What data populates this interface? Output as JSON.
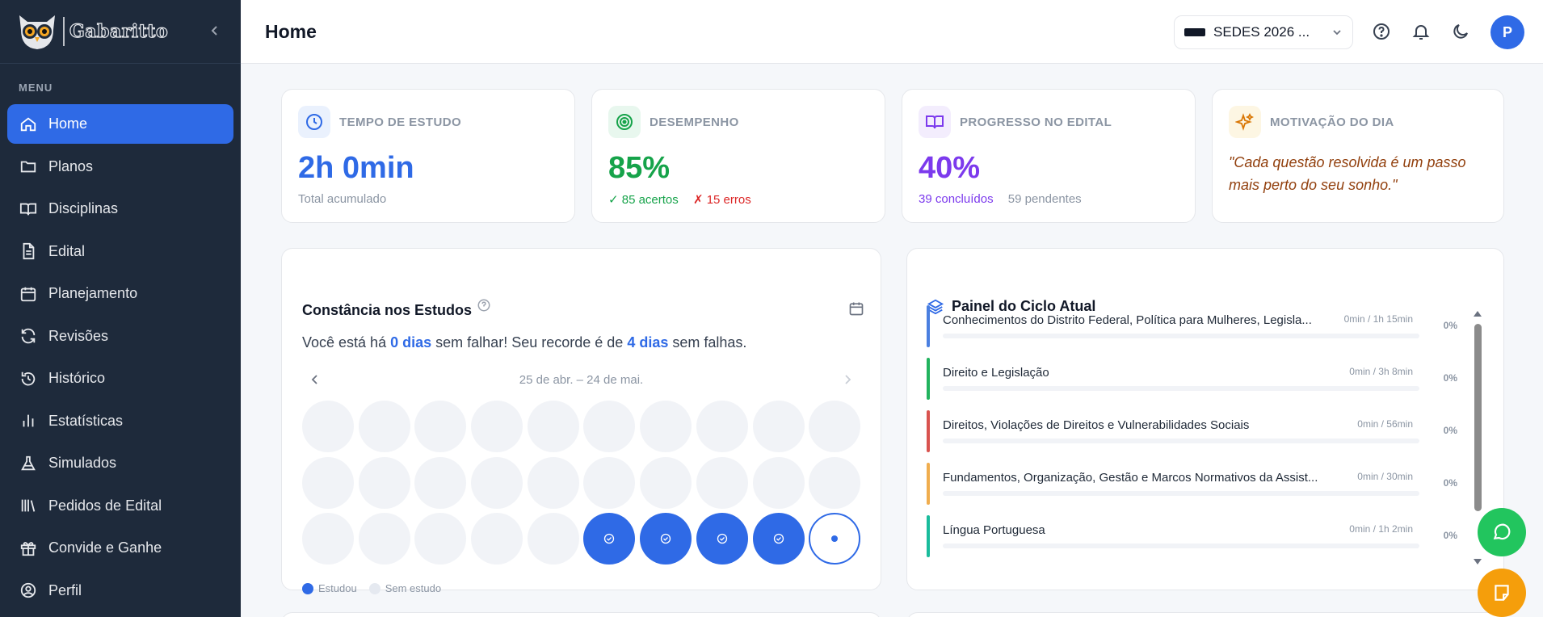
{
  "brand": {
    "name": "Gabaritto"
  },
  "sidebar": {
    "menu_label": "MENU",
    "items": [
      {
        "label": "Home",
        "icon": "home-icon",
        "active": true
      },
      {
        "label": "Planos",
        "icon": "folder-icon"
      },
      {
        "label": "Disciplinas",
        "icon": "book-icon"
      },
      {
        "label": "Edital",
        "icon": "document-icon"
      },
      {
        "label": "Planejamento",
        "icon": "calendar-icon"
      },
      {
        "label": "Revisões",
        "icon": "refresh-icon"
      },
      {
        "label": "Histórico",
        "icon": "history-icon"
      },
      {
        "label": "Estatísticas",
        "icon": "bar-chart-icon"
      },
      {
        "label": "Simulados",
        "icon": "flask-icon"
      },
      {
        "label": "Pedidos de Edital",
        "icon": "library-icon"
      },
      {
        "label": "Convide e Ganhe",
        "icon": "gift-icon"
      },
      {
        "label": "Perfil",
        "icon": "user-circle-icon"
      }
    ]
  },
  "header": {
    "title": "Home",
    "plan": "SEDES 2026 ...",
    "avatar_initial": "P"
  },
  "stats": {
    "study_time": {
      "label": "TEMPO DE ESTUDO",
      "value": "2h 0min",
      "sub": "Total acumulado"
    },
    "performance": {
      "label": "DESEMPENHO",
      "value": "85%",
      "correct": "✓ 85 acertos",
      "errors": "✗ 15 erros"
    },
    "progress": {
      "label": "PROGRESSO NO EDITAL",
      "value": "40%",
      "done": "39 concluídos",
      "pending": "59 pendentes"
    },
    "motivation": {
      "label": "MOTIVAÇÃO DO DIA",
      "quote": "\"Cada questão resolvida é um passo mais perto do seu sonho.\""
    }
  },
  "constancy": {
    "title": "Constância nos Estudos",
    "streak_prefix": "Você está há",
    "streak_current": "0 dias",
    "streak_middle": "sem falhar! Seu recorde é de",
    "streak_record": "4 dias",
    "streak_suffix": "sem falhas.",
    "range": "25 de abr. – 24 de mai.",
    "days": [
      0,
      0,
      0,
      0,
      0,
      0,
      0,
      0,
      0,
      0,
      0,
      0,
      0,
      0,
      0,
      0,
      0,
      0,
      0,
      0,
      0,
      0,
      0,
      0,
      0,
      1,
      1,
      1,
      1,
      2
    ],
    "legend_studied": "Estudou",
    "legend_none": "Sem estudo",
    "colors": {
      "studied": "#2f6ae6",
      "none": "#f1f3f7"
    }
  },
  "cycle": {
    "title": "Painel do Ciclo Atual",
    "subjects": [
      {
        "name": "Conhecimentos do Distrito Federal, Política para Mulheres, Legisla...",
        "time": "0min / 1h 15min",
        "pct": "0%",
        "color": "#4a7fe0"
      },
      {
        "name": "Direito e Legislação",
        "time": "0min / 3h 8min",
        "pct": "0%",
        "color": "#22b35e"
      },
      {
        "name": "Direitos, Violações de Direitos e Vulnerabilidades Sociais",
        "time": "0min / 56min",
        "pct": "0%",
        "color": "#d9534f"
      },
      {
        "name": "Fundamentos, Organização, Gestão e Marcos Normativos da Assist...",
        "time": "0min / 30min",
        "pct": "0%",
        "color": "#f0ad4e"
      },
      {
        "name": "Língua Portuguesa",
        "time": "0min / 1h 2min",
        "pct": "0%",
        "color": "#1abc9c"
      }
    ]
  }
}
